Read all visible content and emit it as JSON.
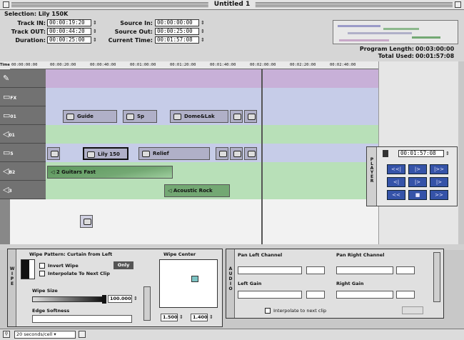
{
  "window": {
    "title": "Untitled 1"
  },
  "header": {
    "selection_label": "Selection: Lily 150K",
    "track_in_label": "Track IN:",
    "track_in": "00:00:19:20",
    "track_out_label": "Track OUT:",
    "track_out": "00:00:44:20",
    "duration_label": "Duration:",
    "duration": "00:00:25:00",
    "source_in_label": "Source In:",
    "source_in": "00:00:00:00",
    "source_out_label": "Source Out:",
    "source_out": "00:00:25:00",
    "current_time_label": "Current Time:",
    "current_time": "00:01:57:08",
    "program_length_label": "Program Length:",
    "program_length": "00:03:00:00",
    "total_used_label": "Total Used:",
    "total_used": "00:01:57:08"
  },
  "ruler": {
    "label": "TimeCode:",
    "ticks": [
      "00:00:00:00",
      "00:00:20:00",
      "00:00:40:00",
      "00:01:00:00",
      "00:01:20:00",
      "00:01:40:00",
      "00:02:00:00",
      "00:02:20:00",
      "00:02:40:00"
    ]
  },
  "tracks": [
    {
      "label": "",
      "sub": "",
      "type": "video"
    },
    {
      "label": "FX",
      "sub": "",
      "type": "video"
    },
    {
      "label": "D",
      "sub": "01",
      "type": "video"
    },
    {
      "label": "A",
      "sub": "01",
      "type": "audio"
    },
    {
      "label": "D",
      "sub": "5",
      "type": "video"
    },
    {
      "label": "A",
      "sub": "B2",
      "type": "audio"
    },
    {
      "label": "A",
      "sub": "3",
      "type": "audio"
    }
  ],
  "clips": {
    "guide": "Guide",
    "sp": "Sp",
    "dome": "Dome&Lak",
    "lily": "Lily 150",
    "relief": "Relief",
    "guitars": "2 Guitars Fast",
    "acoustic": "Acoustic Rock"
  },
  "player": {
    "label": "PLAYER",
    "timecode": "00:01:57:08",
    "buttons": [
      "<<|",
      "|>",
      "|>>",
      "<|",
      "|>",
      "|>",
      "<<",
      "■",
      ">>"
    ]
  },
  "wipe": {
    "side_label": "WIPE",
    "pattern_label": "Wipe Pattern: Curtain from Left",
    "invert_label": "Invert Wipe",
    "only_label": "Only",
    "interpolate_label": "Interpolate To Next Clip",
    "size_label": "Wipe Size",
    "size_value": "100.000",
    "edge_label": "Edge Softness",
    "center_label": "Wipe Center",
    "center_x": "1.500",
    "center_y": "1.400"
  },
  "audio": {
    "side_label": "AUDIO",
    "pan_left_label": "Pan Left Channel",
    "pan_right_label": "Pan Right Channel",
    "left_gain_label": "Left Gain",
    "right_gain_label": "Right Gain",
    "interpolate_label": "Interpolate to next clip"
  },
  "statusbar": {
    "zoom": "20 seconds/cell"
  }
}
